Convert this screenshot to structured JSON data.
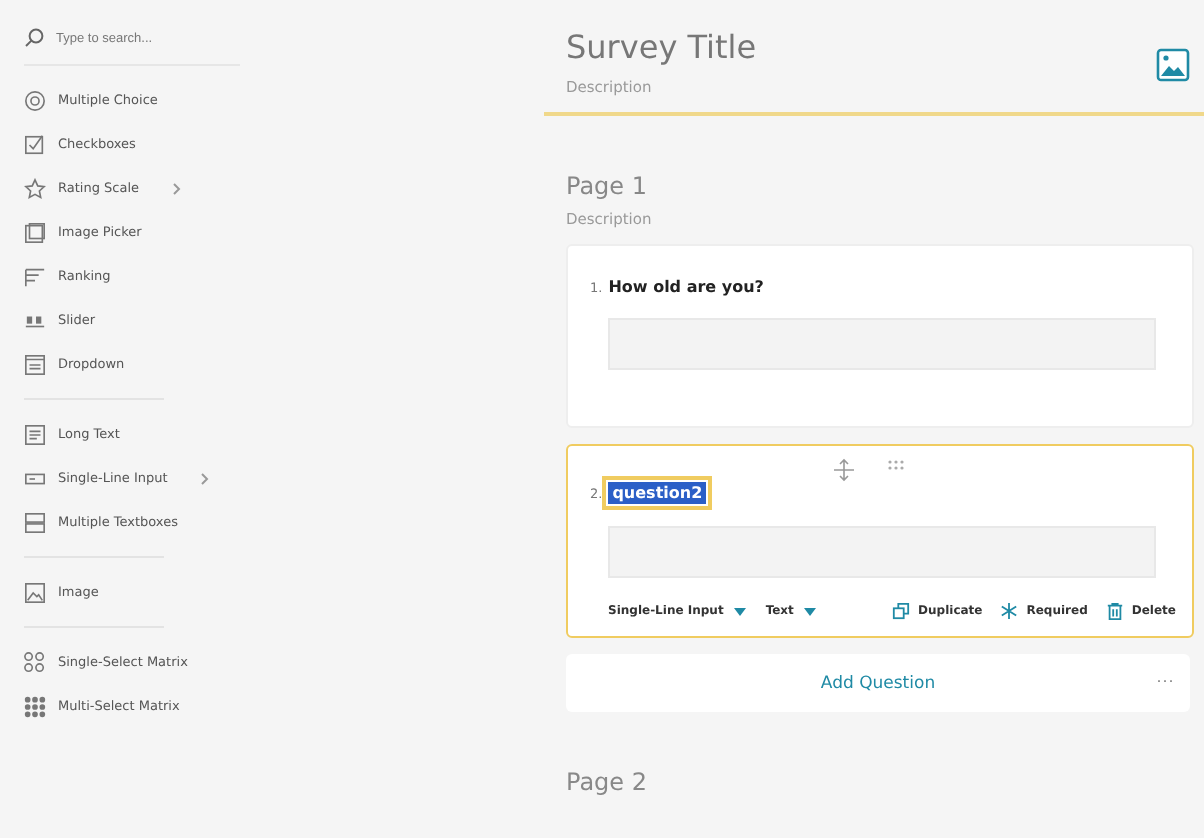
{
  "sidebar": {
    "search": {
      "placeholder": "Type to search..."
    },
    "groups": [
      [
        {
          "kind": "radio",
          "label": "Multiple Choice",
          "submenu": false
        },
        {
          "kind": "checkbox",
          "label": "Checkboxes",
          "submenu": false
        },
        {
          "kind": "star",
          "label": "Rating Scale",
          "submenu": true
        },
        {
          "kind": "image-picker",
          "label": "Image Picker",
          "submenu": false
        },
        {
          "kind": "ranking",
          "label": "Ranking",
          "submenu": false
        },
        {
          "kind": "slider",
          "label": "Slider",
          "submenu": false
        },
        {
          "kind": "dropdown",
          "label": "Dropdown",
          "submenu": false
        }
      ],
      [
        {
          "kind": "long-text",
          "label": "Long Text",
          "submenu": false
        },
        {
          "kind": "single-line",
          "label": "Single-Line Input",
          "submenu": true
        },
        {
          "kind": "multi-text",
          "label": "Multiple Textboxes",
          "submenu": false
        }
      ],
      [
        {
          "kind": "image",
          "label": "Image",
          "submenu": false
        }
      ],
      [
        {
          "kind": "single-matrix",
          "label": "Single-Select Matrix",
          "submenu": false
        },
        {
          "kind": "multi-matrix",
          "label": "Multi-Select Matrix",
          "submenu": false
        }
      ]
    ]
  },
  "survey": {
    "title": "Survey Title",
    "description": "Description"
  },
  "pages": [
    {
      "title": "Page 1",
      "description": "Description",
      "questions": [
        {
          "number": "1.",
          "title": "How old are you?",
          "selected": false
        },
        {
          "number": "2.",
          "title": "question2",
          "selected": true,
          "type": "Single-Line Input",
          "input_type": "Text",
          "actions": [
            {
              "kind": "duplicate",
              "label": "Duplicate"
            },
            {
              "kind": "required",
              "label": "Required"
            },
            {
              "kind": "delete",
              "label": "Delete"
            }
          ]
        }
      ],
      "add_question": "Add Question",
      "more": "···"
    },
    {
      "title": "Page 2"
    }
  ]
}
